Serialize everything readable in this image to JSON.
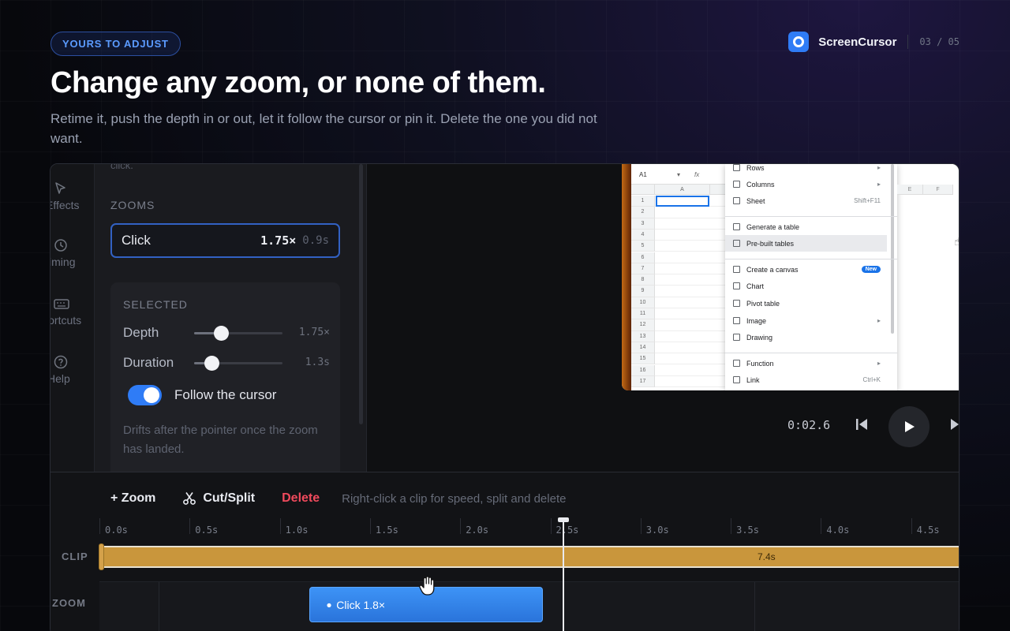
{
  "header": {
    "eyebrow": "YOURS TO ADJUST",
    "brand_name": "ScreenCursor",
    "page_indicator": "03 / 05",
    "headline": "Change any zoom, or none of them.",
    "subline": "Retime it, push the depth in or out, let it follow the cursor or pin it. Delete the one you did not want."
  },
  "rail": {
    "items": [
      {
        "label": "Effects",
        "icon": "cursor-arrow-icon"
      },
      {
        "label": "Timing",
        "icon": "clock-icon"
      },
      {
        "label": "Shortcuts",
        "icon": "keyboard-icon"
      },
      {
        "label": "Help",
        "icon": "help-circle-icon"
      }
    ]
  },
  "panel": {
    "clipped_text": "click.",
    "zooms_title": "ZOOMS",
    "zoom_item": {
      "name": "Click",
      "depth": "1.75×",
      "duration": "0.9s"
    },
    "selected": {
      "title": "SELECTED",
      "depth_label": "Depth",
      "depth_value": "1.75×",
      "depth_level": 0.3,
      "duration_label": "Duration",
      "duration_value": "1.3s",
      "duration_level": 0.2,
      "follow_label": "Follow the cursor",
      "follow_on": true,
      "help": "Drifts after the pointer once the zoom has landed."
    }
  },
  "preview": {
    "cell_ref": "A1",
    "fx": "fx",
    "col_a": "A",
    "col_e": "E",
    "col_f": "F",
    "rows": [
      "1",
      "2",
      "3",
      "4",
      "5",
      "6",
      "7",
      "8",
      "9",
      "10",
      "11",
      "12",
      "13",
      "14",
      "15",
      "16",
      "17"
    ],
    "menu": [
      {
        "label": "Rows",
        "right": "▸"
      },
      {
        "label": "Columns",
        "right": "▸"
      },
      {
        "label": "Sheet",
        "right": "Shift+F11"
      },
      {
        "label": "Generate a table",
        "right": ""
      },
      {
        "label": "Pre-built tables",
        "right": ""
      },
      {
        "label": "Create a canvas",
        "right": "",
        "badge": "New"
      },
      {
        "label": "Chart",
        "right": ""
      },
      {
        "label": "Pivot table",
        "right": ""
      },
      {
        "label": "Image",
        "right": "▸"
      },
      {
        "label": "Drawing",
        "right": ""
      },
      {
        "label": "Function",
        "right": "▸"
      },
      {
        "label": "Link",
        "right": "Ctrl+K"
      }
    ]
  },
  "player": {
    "time": "0:02.6"
  },
  "timeline": {
    "add_zoom": "+ Zoom",
    "cut_split": "Cut/Split",
    "delete": "Delete",
    "hint": "Right-click a clip for speed, split and delete",
    "ticks": [
      "0.0s",
      "0.5s",
      "1.0s",
      "1.5s",
      "2.0s",
      "2.5s",
      "3.0s",
      "3.5s",
      "4.0s",
      "4.5s"
    ],
    "clip_label": "CLIP",
    "zoom_label": "ZOOM",
    "clip_length": "7.4s",
    "zoom_block": "Click 1.8×",
    "playhead_time": 2.5
  },
  "colors": {
    "accent": "#2f7cf6",
    "danger": "#ef4a5c",
    "clip": "#c9963c"
  }
}
